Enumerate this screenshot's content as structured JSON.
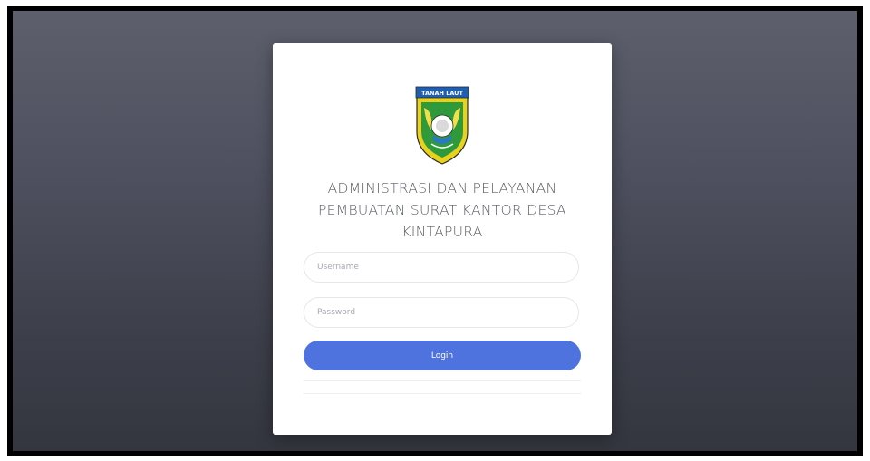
{
  "page": {
    "title": "ADMINISTRASI DAN PELAYANAN PEMBUATAN SURAT KANTOR DESA KINTAPURA",
    "background_color": "#4f5160",
    "accent_color": "#4e73df"
  },
  "logo": {
    "icon": "regency-coat-of-arms-icon",
    "banner_text": "TANAH LAUT"
  },
  "form": {
    "username_placeholder": "Username",
    "username_value": "",
    "password_placeholder": "Password",
    "password_value": "",
    "login_label": "Login"
  }
}
